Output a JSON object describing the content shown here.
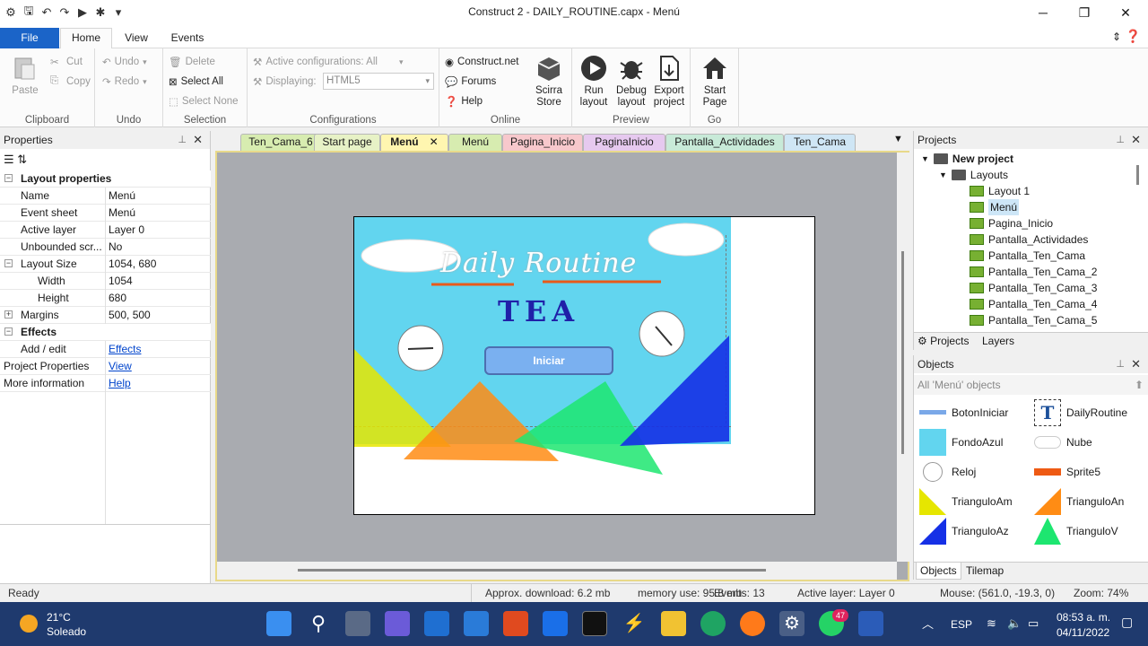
{
  "window": {
    "title": "Construct 2 - DAILY_ROUTINE.capx - Menú"
  },
  "ribbon_tabs": {
    "file": "File",
    "home": "Home",
    "view": "View",
    "events": "Events"
  },
  "ribbon": {
    "clipboard": {
      "paste": "Paste",
      "cut": "Cut",
      "copy": "Copy",
      "label": "Clipboard"
    },
    "undo": {
      "undo": "Undo",
      "redo": "Redo",
      "label": "Undo"
    },
    "selection": {
      "delete": "Delete",
      "select_all": "Select All",
      "select_none": "Select None",
      "label": "Selection"
    },
    "configurations": {
      "active": "Active configurations: All",
      "displaying": "Displaying:",
      "displaying_value": "HTML5",
      "label": "Configurations"
    },
    "online": {
      "construct_net": "Construct.net",
      "forums": "Forums",
      "help": "Help",
      "scirra_store_1": "Scirra",
      "scirra_store_2": "Store",
      "label": "Online"
    },
    "preview": {
      "run_1": "Run",
      "run_2": "layout",
      "debug_1": "Debug",
      "debug_2": "layout",
      "export_1": "Export",
      "export_2": "project",
      "label": "Preview"
    },
    "go": {
      "start_1": "Start",
      "start_2": "Page",
      "label": "Go"
    }
  },
  "properties": {
    "title": "Properties",
    "section_layout": "Layout properties",
    "rows": [
      {
        "k": "Name",
        "v": "Menú"
      },
      {
        "k": "Event sheet",
        "v": "Menú"
      },
      {
        "k": "Active layer",
        "v": "Layer 0"
      },
      {
        "k": "Unbounded scr...",
        "v": "No"
      },
      {
        "k": "Layout Size",
        "v": "1054, 680"
      },
      {
        "k": "Width",
        "v": "1054"
      },
      {
        "k": "Height",
        "v": "680"
      },
      {
        "k": "Margins",
        "v": "500, 500"
      }
    ],
    "section_effects": "Effects",
    "add_edit": "Add / edit",
    "effects_link": "Effects",
    "project_properties": "Project Properties",
    "view_link": "View",
    "more_info": "More information",
    "help_link": "Help"
  },
  "doc_tabs": [
    "Ten_Cama_6",
    "Start page",
    "Menú",
    "Menú",
    "Pagina_Inicio",
    "PaginaInicio",
    "Pantalla_Actividades",
    "Ten_Cama"
  ],
  "layout_canvas": {
    "heading": "Daily Routine",
    "subheading": "TEA",
    "button": "Iniciar"
  },
  "projects": {
    "title": "Projects",
    "root": "New project",
    "layouts_folder": "Layouts",
    "layouts": [
      "Layout 1",
      "Menú",
      "Pagina_Inicio",
      "Pantalla_Actividades",
      "Pantalla_Ten_Cama",
      "Pantalla_Ten_Cama_2",
      "Pantalla_Ten_Cama_3",
      "Pantalla_Ten_Cama_4",
      "Pantalla_Ten_Cama_5"
    ],
    "tab_projects": "Projects",
    "tab_layers": "Layers"
  },
  "objects": {
    "title": "Objects",
    "filter": "All 'Menú' objects",
    "items": [
      "BotonIniciar",
      "DailyRoutine",
      "FondoAzul",
      "Nube",
      "Reloj",
      "Sprite5",
      "TrianguloAm",
      "TrianguloAn",
      "TrianguloAz",
      "TrianguloV"
    ],
    "tab_objects": "Objects",
    "tab_tilemap": "Tilemap"
  },
  "status": {
    "ready": "Ready",
    "download": "Approx. download: 6.2 mb",
    "memory": "memory use: 95.8 mb",
    "events": "Events: 13",
    "active_layer": "Active layer: Layer 0",
    "mouse": "Mouse: (561.0, -19.3, 0)",
    "zoom": "Zoom: 74%"
  },
  "taskbar": {
    "weather_temp": "21°C",
    "weather_desc": "Soleado",
    "lang": "ESP",
    "time": "08:53 a. m.",
    "date": "04/11/2022",
    "whatsapp_badge": "47"
  }
}
